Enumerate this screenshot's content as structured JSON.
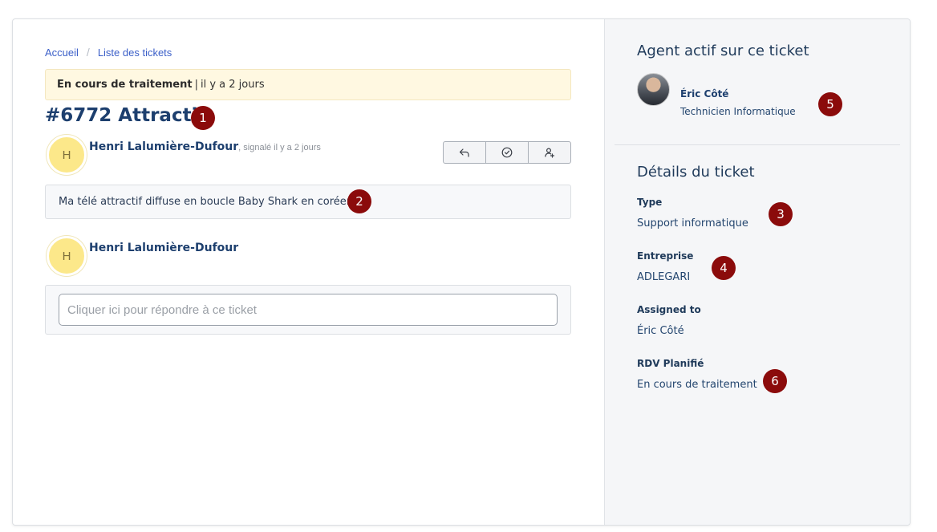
{
  "breadcrumb": {
    "home": "Accueil",
    "separator": "/",
    "list": "Liste des tickets"
  },
  "status": {
    "label": "En cours de traitement",
    "separator": "|",
    "when": "il y a 2 jours"
  },
  "ticket": {
    "number": "#6772",
    "title": "Attractif"
  },
  "markers": [
    "1",
    "2",
    "3",
    "4",
    "5",
    "6"
  ],
  "message": {
    "avatar_initial": "H",
    "author": "Henri Lalumière-Dufour",
    "meta": ", signalé il y a 2 jours",
    "body": "Ma télé attractif diffuse en boucle Baby Shark en coréen"
  },
  "actions": {
    "icons": [
      "reply-icon",
      "check-circle-icon",
      "assign-user-icon"
    ]
  },
  "reply": {
    "avatar_initial": "H",
    "author": "Henri Lalumière-Dufour",
    "placeholder": "Cliquer ici pour répondre à ce ticket"
  },
  "agent_section": {
    "title": "Agent actif sur ce ticket",
    "name": "Éric Côté",
    "role": "Technicien Informatique"
  },
  "details": {
    "title": "Détails du ticket",
    "fields": [
      {
        "label": "Type",
        "value": "Support informatique"
      },
      {
        "label": "Entreprise",
        "value": "ADLEGARI"
      },
      {
        "label": "Assigned to",
        "value": "Éric Côté"
      },
      {
        "label": "RDV Planifié",
        "value": "En cours de traitement"
      }
    ]
  },
  "colors": {
    "accent": "#1d3f6e",
    "link": "#3b5fc8",
    "marker": "#8b0b0b",
    "banner": "#fff8e1",
    "avatar": "#fce88a"
  }
}
